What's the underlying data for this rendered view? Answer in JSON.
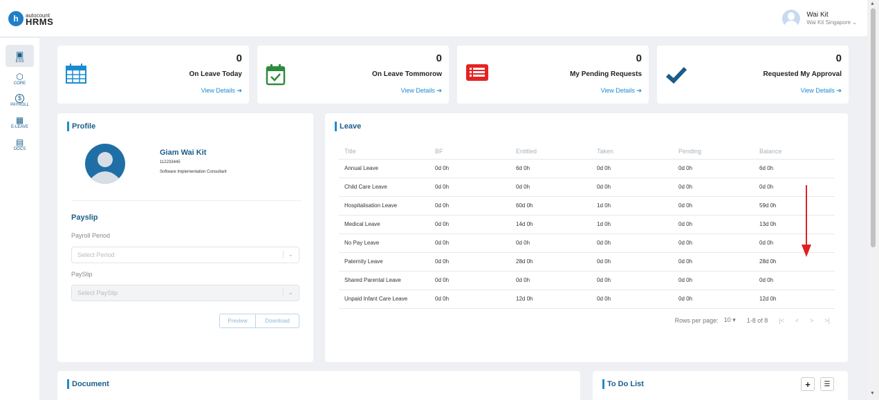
{
  "app": {
    "logo_small": "autocount",
    "logo_big": "HRMS",
    "logo_letter": "h"
  },
  "user": {
    "name": "Wai Kit",
    "company": "Wai Kit Singapore"
  },
  "sidebar": {
    "items": [
      {
        "label": "ESS",
        "icon": "id-card-icon",
        "glyph": "▣"
      },
      {
        "label": "CORE",
        "icon": "cube-icon",
        "glyph": "⬡"
      },
      {
        "label": "PAYROLL",
        "icon": "dollar-icon",
        "glyph": "$"
      },
      {
        "label": "E-LEAVE",
        "icon": "calendar-icon",
        "glyph": "▦"
      },
      {
        "label": "DOCS",
        "icon": "document-icon",
        "glyph": "▤"
      }
    ]
  },
  "stats": [
    {
      "value": "0",
      "label": "On Leave Today",
      "link": "View Details",
      "icon": "calendar-icon"
    },
    {
      "value": "0",
      "label": "On Leave Tommorow",
      "link": "View Details",
      "icon": "calendar-check-icon"
    },
    {
      "value": "0",
      "label": "My Pending Requests",
      "link": "View Details",
      "icon": "list-icon"
    },
    {
      "value": "0",
      "label": "Requested My Approval",
      "link": "View Details",
      "icon": "checkmark-icon"
    }
  ],
  "profile": {
    "title": "Profile",
    "name": "Giam Wai Kit",
    "id": "112233445",
    "position": "Software Implementation Consultant"
  },
  "payslip": {
    "title": "Payslip",
    "period_label": "Payroll Period",
    "period_placeholder": "Select Period",
    "slip_label": "PaySlip",
    "slip_placeholder": "Select PaySlip",
    "preview": "Preview",
    "download": "Download"
  },
  "leave": {
    "title": "Leave",
    "columns": [
      "Title",
      "BF",
      "Entitled",
      "Taken",
      "Pending",
      "Balance"
    ],
    "rows": [
      [
        "Annual Leave",
        "0d 0h",
        "6d 0h",
        "0d 0h",
        "0d 0h",
        "6d 0h"
      ],
      [
        "Child Care Leave",
        "0d 0h",
        "0d 0h",
        "0d 0h",
        "0d 0h",
        "0d 0h"
      ],
      [
        "Hospitalisation Leave",
        "0d 0h",
        "60d 0h",
        "1d 0h",
        "0d 0h",
        "59d 0h"
      ],
      [
        "Medical Leave",
        "0d 0h",
        "14d 0h",
        "1d 0h",
        "0d 0h",
        "13d 0h"
      ],
      [
        "No Pay Leave",
        "0d 0h",
        "0d 0h",
        "0d 0h",
        "0d 0h",
        "0d 0h"
      ],
      [
        "Paternity Leave",
        "0d 0h",
        "28d 0h",
        "0d 0h",
        "0d 0h",
        "28d 0h"
      ],
      [
        "Shared Parental Leave",
        "0d 0h",
        "0d 0h",
        "0d 0h",
        "0d 0h",
        "0d 0h"
      ],
      [
        "Unpaid Infant Care Leave",
        "0d 0h",
        "12d 0h",
        "0d 0h",
        "0d 0h",
        "12d 0h"
      ]
    ],
    "rows_per_page_label": "Rows per page:",
    "rows_per_page": "10",
    "range": "1-8 of 8"
  },
  "document": {
    "title": "Document"
  },
  "todo": {
    "title": "To Do List"
  },
  "colors": {
    "accent": "#1a8bd1",
    "heading": "#1a5c8a",
    "annotation_arrow": "#e02020"
  }
}
